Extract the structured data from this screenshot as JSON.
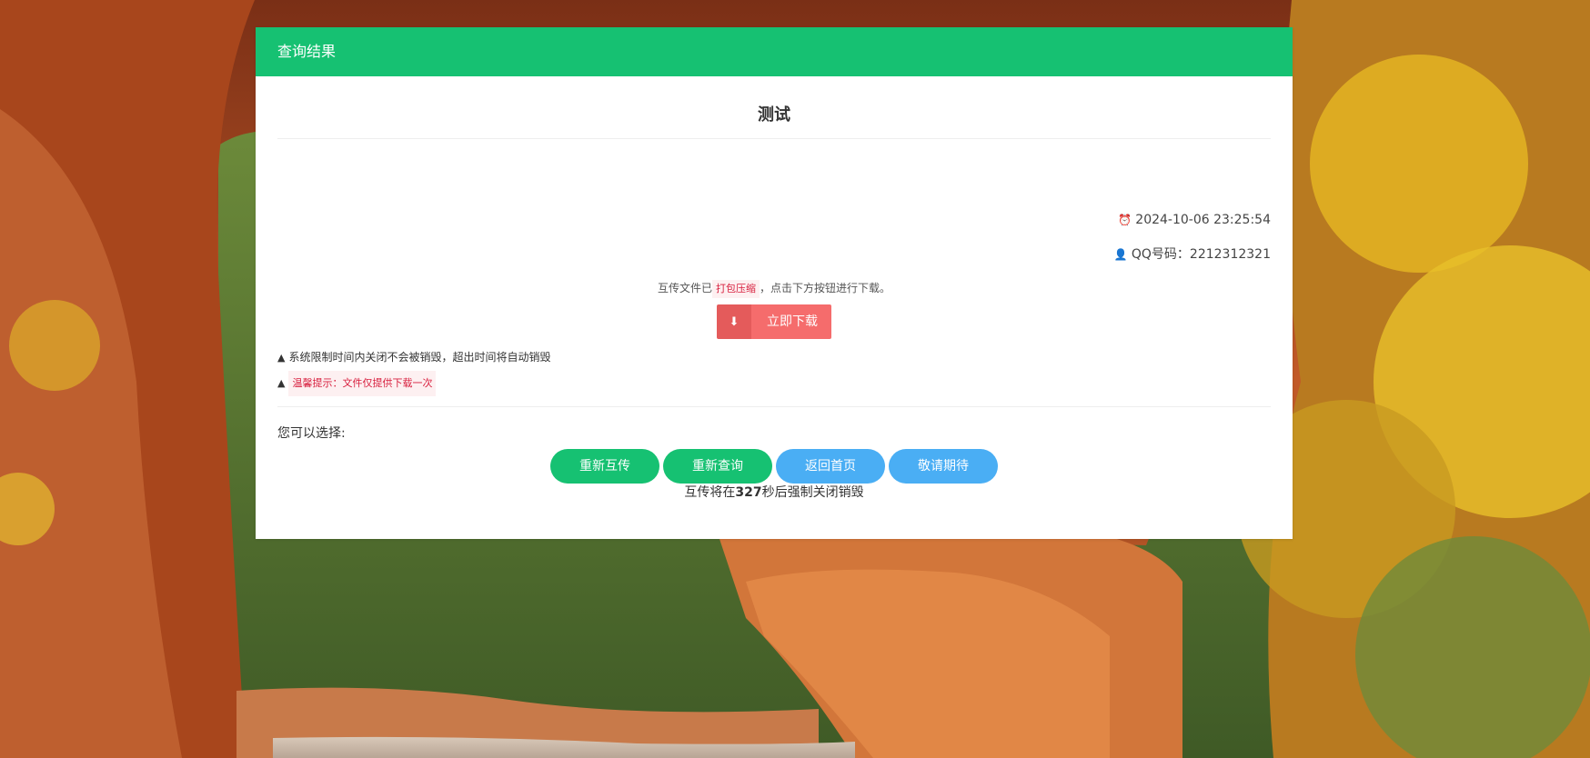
{
  "header": {
    "title": "查询结果"
  },
  "file": {
    "name": "测试",
    "time": "2024-10-06 23:25:54",
    "qq_label": "QQ号码：",
    "qq_value": "2212312321"
  },
  "notice": {
    "before": "互传文件已",
    "tag": "打包压缩",
    "after": "，点击下方按钮进行下载。"
  },
  "download_button": {
    "label": "立即下载",
    "icon": "download-icon"
  },
  "warnings": [
    {
      "text": "系统限制时间内关闭不会被销毁，超出时间将自动销毁",
      "icon": "warning-icon"
    },
    {
      "text": "温馨提示：文件仅提供下载一次",
      "icon": "warning-icon"
    }
  ],
  "choose_label": "您可以选择:",
  "actions": [
    {
      "label": "重新互传",
      "color": "#16c172"
    },
    {
      "label": "重新查询",
      "color": "#16c172"
    },
    {
      "label": "返回首页",
      "color": "#4aaef4"
    },
    {
      "label": "敬请期待",
      "color": "#4aaef4"
    }
  ],
  "countdown": {
    "before": "互传将在",
    "seconds": "327",
    "after": "秒后强制关闭销毁"
  },
  "colors": {
    "primary": "#16c172",
    "accent_blue": "#4aaef4",
    "danger": "#f56c6c"
  }
}
